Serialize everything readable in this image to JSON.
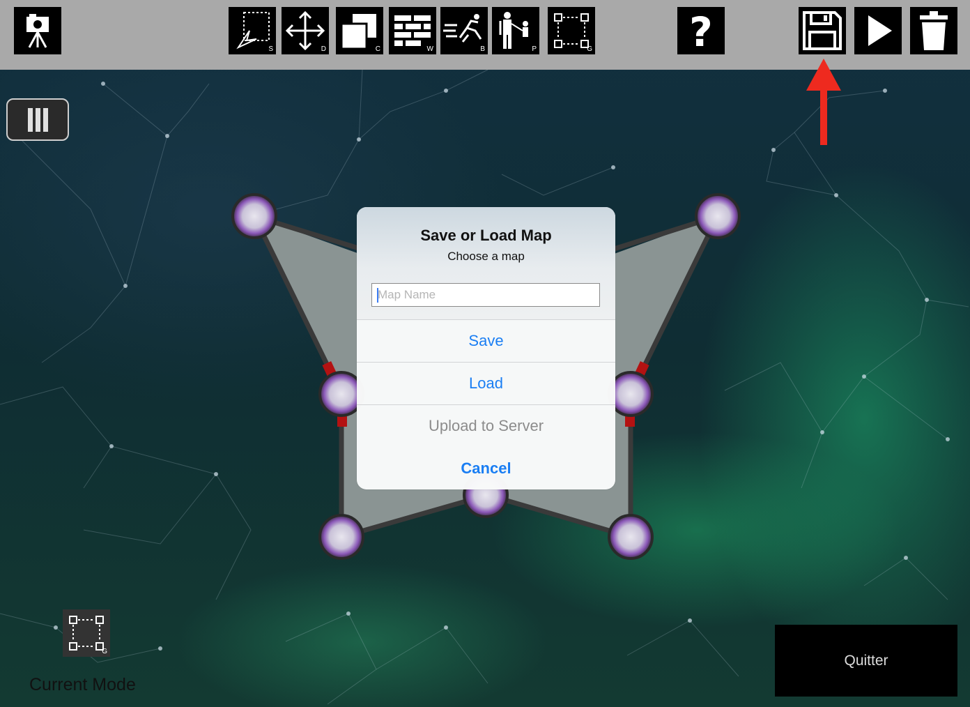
{
  "toolbar": {
    "buttons": [
      {
        "icon": "camera-tripod-icon",
        "key": ""
      },
      {
        "icon": "select-icon",
        "key": "S"
      },
      {
        "icon": "move-icon",
        "key": "D"
      },
      {
        "icon": "copy-icon",
        "key": "C"
      },
      {
        "icon": "wall-icon",
        "key": "W"
      },
      {
        "icon": "runner-icon",
        "key": "B"
      },
      {
        "icon": "person-icon",
        "key": "P"
      },
      {
        "icon": "group-nodes-icon",
        "key": "G"
      },
      {
        "icon": "help-icon",
        "key": ""
      },
      {
        "icon": "save-disk-icon",
        "key": ""
      },
      {
        "icon": "play-icon",
        "key": ""
      },
      {
        "icon": "trash-icon",
        "key": ""
      }
    ]
  },
  "dialog": {
    "title": "Save or Load Map",
    "message": "Choose a map",
    "input_placeholder": "Map Name",
    "save_label": "Save",
    "load_label": "Load",
    "upload_label": "Upload to Server",
    "cancel_label": "Cancel"
  },
  "current_mode": {
    "label": "Current Mode",
    "key": "G"
  },
  "quit_label": "Quitter",
  "colors": {
    "toolbar": "#a9a9a9",
    "accent": "#1a7ef3",
    "annotation_arrow": "#ee2a1f"
  }
}
